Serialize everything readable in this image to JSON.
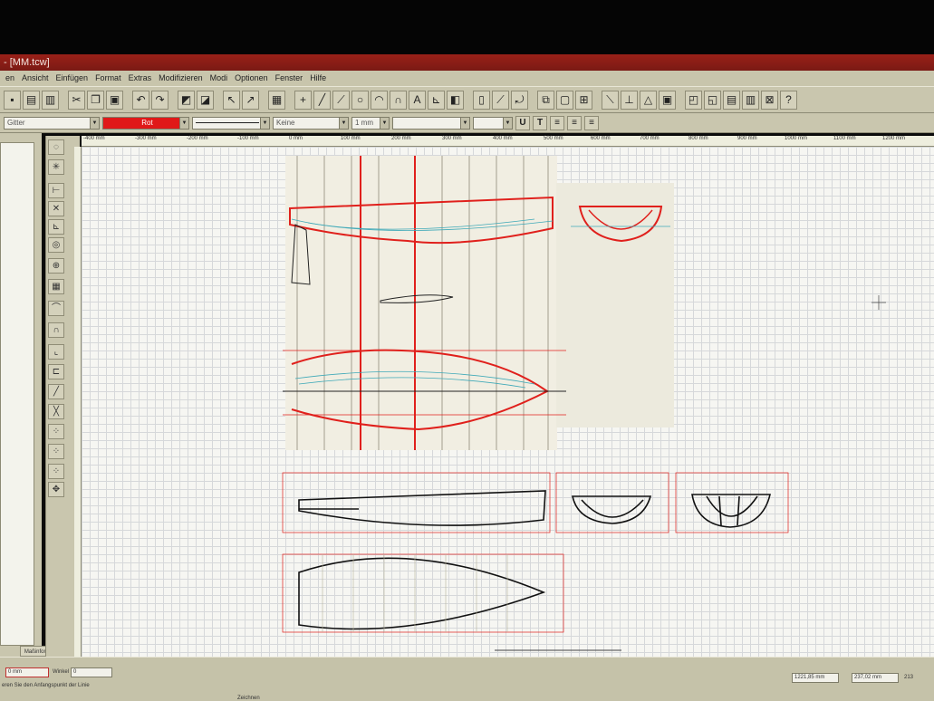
{
  "window": {
    "title": "- [MM.tcw]"
  },
  "menu": [
    "en",
    "Ansicht",
    "Einfügen",
    "Format",
    "Extras",
    "Modifizieren",
    "Modi",
    "Optionen",
    "Fenster",
    "Hilfe"
  ],
  "properties": {
    "layer": "Gitter",
    "color": "Rot",
    "fill": "Keine",
    "line_width": "1 mm"
  },
  "ruler": {
    "labels": [
      "-400 mm",
      "-300 mm",
      "-200 mm",
      "-100 mm",
      "0 mm",
      "100 mm",
      "200 mm",
      "300 mm",
      "400 mm",
      "500 mm",
      "600 mm",
      "700 mm",
      "800 mm",
      "900 mm",
      "1000 mm",
      "1100 mm",
      "1200 mm"
    ]
  },
  "left_panel": {
    "tab_label": "Maßinformationen"
  },
  "status": {
    "prompt": "eren Sie den Anfangspunkt der Linie",
    "field1": "0 mm",
    "field2_label": "Winkel",
    "field2": "0",
    "coord_x": "1221,85 mm",
    "coord_y": "237,02 mm",
    "zoom": "213",
    "taskbar_item": "Zeichnen"
  }
}
